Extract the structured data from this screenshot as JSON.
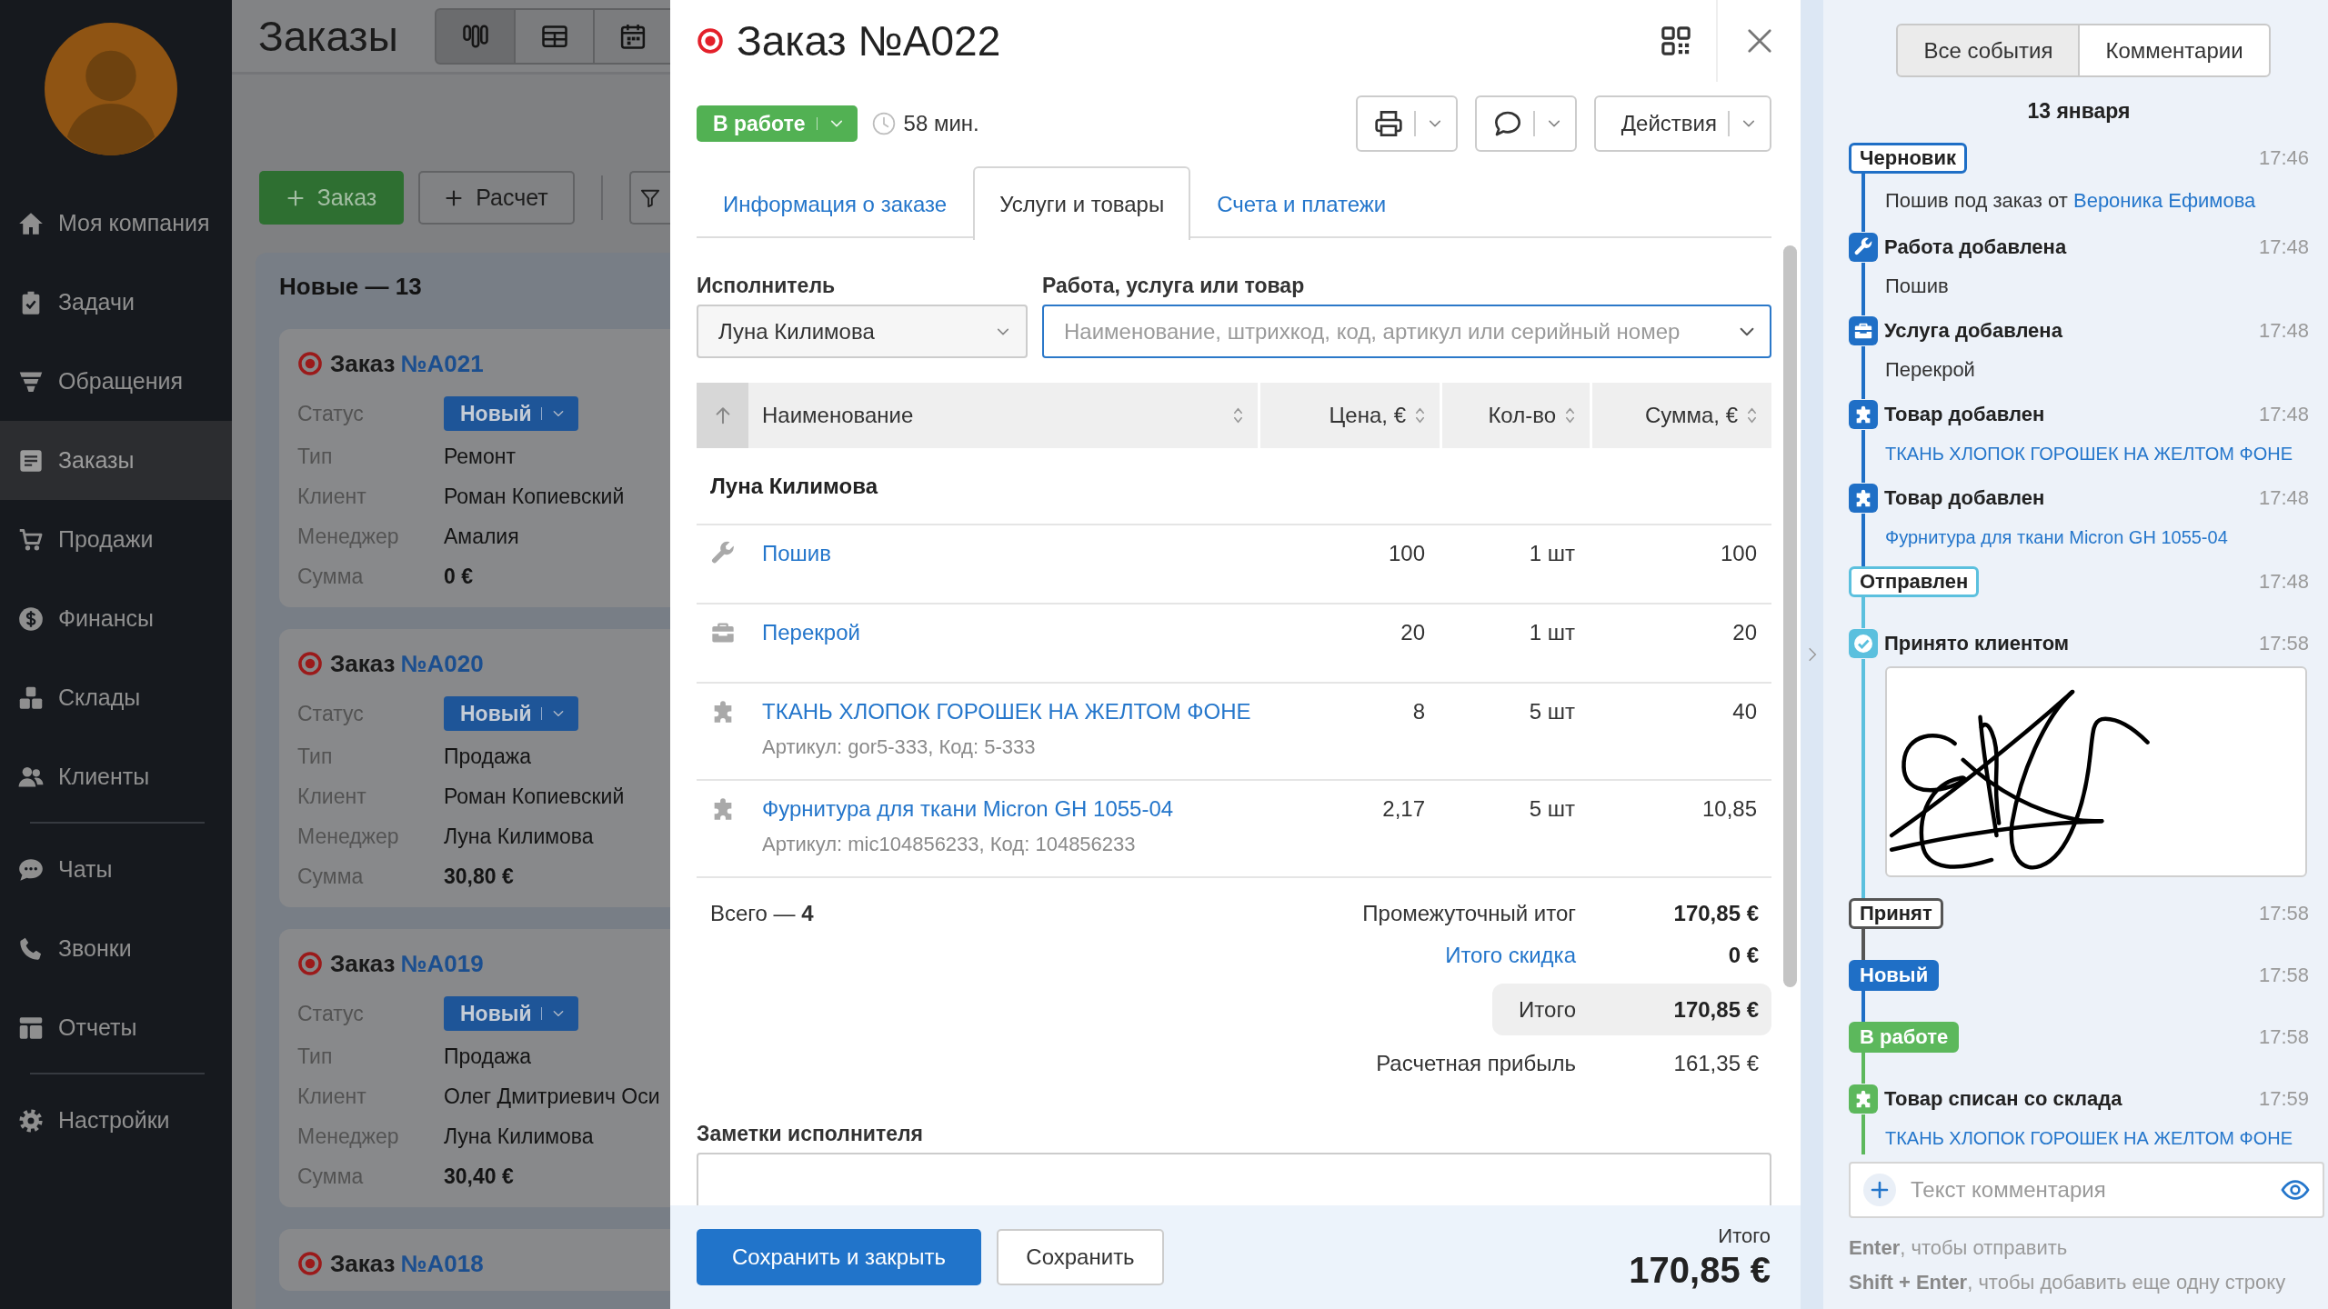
{
  "sidebar": {
    "groups": [
      {
        "items": [
          {
            "label": "Моя компания",
            "selected": false
          },
          {
            "label": "Задачи",
            "selected": false
          },
          {
            "label": "Обращения",
            "selected": false
          },
          {
            "label": "Заказы",
            "selected": true
          },
          {
            "label": "Продажи",
            "selected": false
          },
          {
            "label": "Финансы",
            "selected": false
          },
          {
            "label": "Склады",
            "selected": false
          },
          {
            "label": "Клиенты",
            "selected": false
          }
        ]
      },
      {
        "items": [
          {
            "label": "Чаты",
            "selected": false
          },
          {
            "label": "Звонки",
            "selected": false
          },
          {
            "label": "Отчеты",
            "selected": false
          }
        ]
      },
      {
        "items": [
          {
            "label": "Настройки",
            "selected": false
          }
        ]
      }
    ]
  },
  "orders_page": {
    "title": "Заказы",
    "views": [
      {
        "selected": true
      },
      {
        "selected": false
      },
      {
        "selected": false
      }
    ],
    "toolbar": [
      {
        "kind": "primary",
        "label": "Заказ"
      },
      {
        "kind": "secondary",
        "label": "Расчет"
      },
      {
        "kind": "filter"
      }
    ],
    "column": {
      "title": "Новые — 13",
      "cards": [
        {
          "title": "Заказ",
          "number": "№А021",
          "fields": [
            {
              "kind": "status",
              "label": "Статус",
              "value": "Новый"
            },
            {
              "kind": "text",
              "label": "Тип",
              "value": "Ремонт"
            },
            {
              "kind": "text",
              "label": "Клиент",
              "value": "Роман Копиевский"
            },
            {
              "kind": "text",
              "label": "Менеджер",
              "value": "Амалия"
            },
            {
              "kind": "amount",
              "label": "Сумма",
              "value": "0 €"
            }
          ]
        },
        {
          "title": "Заказ",
          "number": "№А020",
          "fields": [
            {
              "kind": "status",
              "label": "Статус",
              "value": "Новый"
            },
            {
              "kind": "text",
              "label": "Тип",
              "value": "Продажа"
            },
            {
              "kind": "text",
              "label": "Клиент",
              "value": "Роман Копиевский"
            },
            {
              "kind": "text",
              "label": "Менеджер",
              "value": "Луна Килимова"
            },
            {
              "kind": "amount",
              "label": "Сумма",
              "value": "30,80 €"
            }
          ]
        },
        {
          "title": "Заказ",
          "number": "№А019",
          "fields": [
            {
              "kind": "status",
              "label": "Статус",
              "value": "Новый"
            },
            {
              "kind": "text",
              "label": "Тип",
              "value": "Продажа"
            },
            {
              "kind": "text",
              "label": "Клиент",
              "value": "Олег Дмитриевич Оси"
            },
            {
              "kind": "text",
              "label": "Менеджер",
              "value": "Луна Килимова"
            },
            {
              "kind": "amount",
              "label": "Сумма",
              "value": "30,40 €"
            }
          ]
        },
        {
          "title": "Заказ",
          "number": "№А018"
        }
      ]
    }
  },
  "order_modal": {
    "title": "Заказ №А022",
    "status": "В работе",
    "timer": "58 мин.",
    "actions": [
      {
        "kind": "print"
      },
      {
        "kind": "chat"
      },
      {
        "kind": "menu",
        "label": "Действия"
      }
    ],
    "tabs": [
      {
        "label": "Информация о заказе",
        "selected": false
      },
      {
        "label": "Услуги и товары",
        "selected": true
      },
      {
        "label": "Счета и платежи",
        "selected": false
      }
    ],
    "performer": {
      "label": "Исполнитель",
      "value": "Луна Килимова"
    },
    "item_search": {
      "label": "Работа, услуга или товар",
      "placeholder": "Наименование, штрихкод, код, артикул или серийный номер"
    },
    "table": {
      "columns": [
        "Наименование",
        "Цена, €",
        "Кол-во",
        "Сумма, €"
      ],
      "groups": [
        {
          "name": "Луна Килимова",
          "rows": [
            {
              "kind": "work",
              "name": "Пошив",
              "price": "100",
              "quantity": "1 шт",
              "sum": "100"
            },
            {
              "kind": "service",
              "name": "Перекрой",
              "price": "20",
              "quantity": "1 шт",
              "sum": "20"
            },
            {
              "kind": "product",
              "name": "ТКАНЬ ХЛОПОК ГОРОШЕК НА ЖЕЛТОМ ФОНЕ",
              "details": "Артикул: gor5-333, Код: 5-333",
              "price": "8",
              "quantity": "5 шт",
              "sum": "40"
            },
            {
              "kind": "product",
              "name": "Фурнитура для ткани Micron GH 1055-04",
              "details": "Артикул: mic104856233, Код: 104856233",
              "price": "2,17",
              "quantity": "5 шт",
              "sum": "10,85"
            }
          ]
        }
      ]
    },
    "count": "Всего — **4**",
    "totals": [
      {
        "kind": "subtotal",
        "label": "Промежуточный итог",
        "value": "170,85 €"
      },
      {
        "kind": "discount",
        "label": "Итого скидка",
        "value": "0 €"
      },
      {
        "kind": "total",
        "label": "Итого",
        "value": "170,85 €"
      },
      {
        "kind": "profit",
        "label": "Расчетная прибыль",
        "value": "161,35 €"
      }
    ],
    "notes": {
      "label": "Заметки исполнителя"
    },
    "buttons": [
      {
        "kind": "primary",
        "label": "Сохранить и закрыть"
      },
      {
        "kind": "secondary",
        "label": "Сохранить"
      }
    ],
    "grand_total": {
      "label": "Итого",
      "value": "170,85 €"
    }
  },
  "history": {
    "filters": [
      {
        "label": "Все события",
        "selected": true
      },
      {
        "label": "Комментарии",
        "selected": false
      }
    ],
    "date": "13 января",
    "events": [
      {
        "kind": "status",
        "label": "Черновик",
        "filled": false,
        "color": "#1f6fc6",
        "time": "17:46",
        "detail": "Пошив под заказ от",
        "link": "Вероника Ефимова"
      },
      {
        "kind": "work",
        "title": "Работа добавлена",
        "time": "17:48",
        "detail": "Пошив"
      },
      {
        "kind": "service",
        "title": "Услуга добавлена",
        "time": "17:48",
        "detail": "Перекрой"
      },
      {
        "kind": "product",
        "title": "Товар добавлен",
        "time": "17:48",
        "link": "ТКАНЬ ХЛОПОК ГОРОШЕК НА ЖЕЛТОМ ФОНЕ"
      },
      {
        "kind": "product",
        "title": "Товар добавлен",
        "time": "17:48",
        "link": "Фурнитура для ткани Micron GH 1055-04"
      },
      {
        "kind": "status",
        "label": "Отправлен",
        "filled": false,
        "color": "#5bc0de",
        "time": "17:48"
      },
      {
        "kind": "signature",
        "title": "Принято клиентом",
        "time": "17:58"
      },
      {
        "kind": "status",
        "label": "Принят",
        "filled": false,
        "color": "#555555",
        "time": "17:58"
      },
      {
        "kind": "status",
        "label": "Новый",
        "filled": true,
        "color": "#1f6fc6",
        "time": "17:58"
      },
      {
        "kind": "status",
        "label": "В работе",
        "filled": true,
        "color": "#5cb85c",
        "time": "17:58"
      },
      {
        "kind": "product",
        "title": "Товар списан со склада",
        "time": "17:59",
        "link": "ТКАНЬ ХЛОПОК ГОРОШЕК НА ЖЕЛТОМ ФОНЕ"
      }
    ],
    "comment": {
      "placeholder": "Текст комментария"
    },
    "hints": [
      "**Enter**, чтобы отправить",
      "**Shift + Enter**, чтобы добавить еще одну строку"
    ]
  }
}
